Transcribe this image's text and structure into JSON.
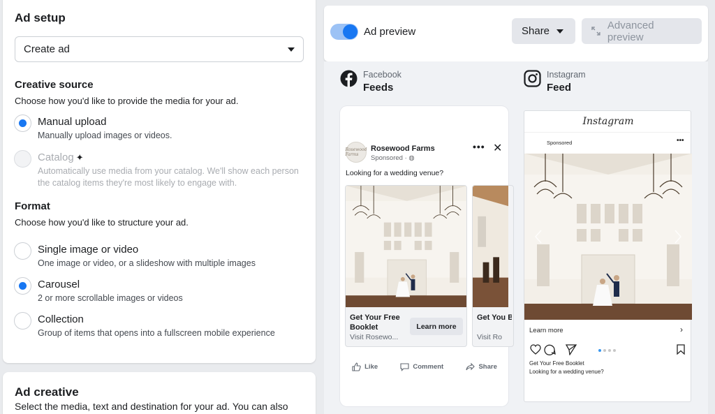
{
  "setup": {
    "title": "Ad setup",
    "dropdown_value": "Create ad",
    "creative_source": {
      "title": "Creative source",
      "desc": "Choose how you'd like to provide the media for your ad.",
      "options": [
        {
          "label": "Manual upload",
          "sub": "Manually upload images or videos.",
          "selected": true
        },
        {
          "label": "Catalog",
          "sub": "Automatically use media from your catalog. We'll show each person the catalog items they're most likely to engage with.",
          "selected": false,
          "disabled": true
        }
      ]
    },
    "format": {
      "title": "Format",
      "desc": "Choose how you'd like to structure your ad.",
      "options": [
        {
          "label": "Single image or video",
          "sub": "One image or video, or a slideshow with multiple images",
          "selected": false
        },
        {
          "label": "Carousel",
          "sub": "2 or more scrollable images or videos",
          "selected": true
        },
        {
          "label": "Collection",
          "sub": "Group of items that opens into a fullscreen mobile experience",
          "selected": false
        }
      ]
    }
  },
  "creative": {
    "title": "Ad creative",
    "desc": "Select the media, text and destination for your ad. You can also"
  },
  "preview_bar": {
    "toggle_label": "Ad preview",
    "toggle_on": true,
    "share_label": "Share",
    "advanced_label": "Advanced preview"
  },
  "facebook": {
    "platform": "Facebook",
    "placement": "Feeds",
    "page_name": "Rosewood Farms",
    "sponsored": "Sponsored · ",
    "avatar_text": "Rosewood Farms",
    "post_text": "Looking for a wedding venue?",
    "cards": [
      {
        "title": "Get Your Free Booklet",
        "sub": "Visit Rosewo...",
        "cta": "Learn more"
      },
      {
        "title": "Get You Booklet",
        "sub": "Visit Ro"
      }
    ],
    "actions": [
      "Like",
      "Comment",
      "Share"
    ]
  },
  "instagram": {
    "platform": "Instagram",
    "placement": "Feed",
    "brand": "Instagram",
    "sponsored": "Sponsored",
    "learn_more": "Learn more",
    "caption1": "Get Your Free Booklet",
    "caption2": "Looking for a wedding venue?",
    "dots_total": 4,
    "dots_active": 1
  },
  "colors": {
    "accent": "#1877f2",
    "page_bg": "#e9ebee",
    "preview_bg": "#f0f2f5"
  }
}
